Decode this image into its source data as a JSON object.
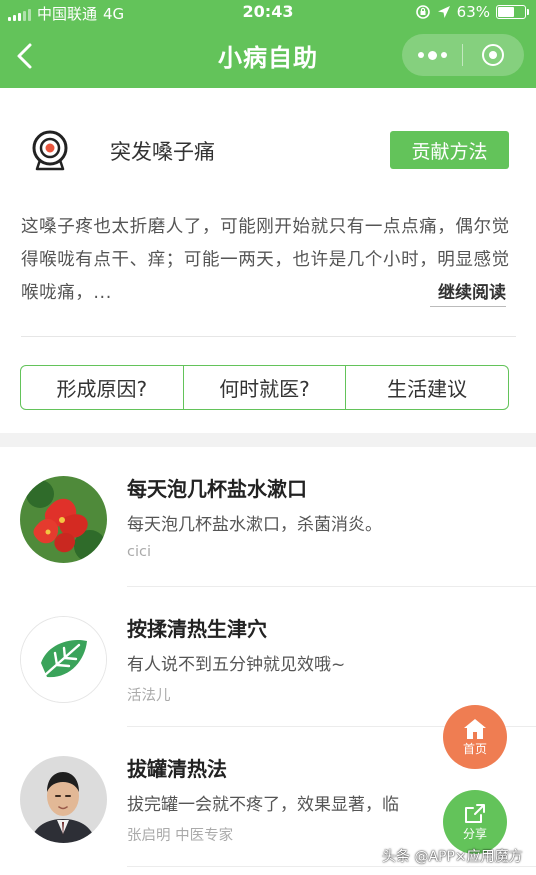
{
  "status_bar": {
    "carrier": "中国联通",
    "network": "4G",
    "time": "20:43",
    "battery": "63%",
    "battery_level": 0.63
  },
  "nav": {
    "title": "小病自助"
  },
  "topic": {
    "title": "突发嗓子痛",
    "contribute_label": "贡献方法",
    "description": "这嗓子疼也太折磨人了，可能刚开始就只有一点点痛，偶尔觉得喉咙有点干、痒；可能一两天，也许是几个小时，明显感觉喉咙痛，...",
    "read_more_label": "继续阅读",
    "tabs": [
      "形成原因?",
      "何时就医?",
      "生活建议"
    ]
  },
  "methods": [
    {
      "title": "每天泡几杯盐水漱口",
      "summary": "每天泡几杯盐水漱口，杀菌消炎。",
      "author": "cici",
      "thumb": "red-flower-photo"
    },
    {
      "title": "按揉清热生津穴",
      "summary": "有人说不到五分钟就见效哦~",
      "author": "活法儿",
      "thumb": "green-leaf-logo"
    },
    {
      "title": "拔罐清热法",
      "summary": "拔完罐一会就不疼了，效果显著，临",
      "author": "张启明 中医专家",
      "thumb": "doctor-portrait"
    }
  ],
  "fab": {
    "home_label": "首页",
    "share_label": "分享"
  },
  "watermark": "头条 @APP×应用魔方",
  "colors": {
    "brand_green": "#63c35a",
    "home_orange": "#ef7d52",
    "separator": "#f2f2f2"
  }
}
